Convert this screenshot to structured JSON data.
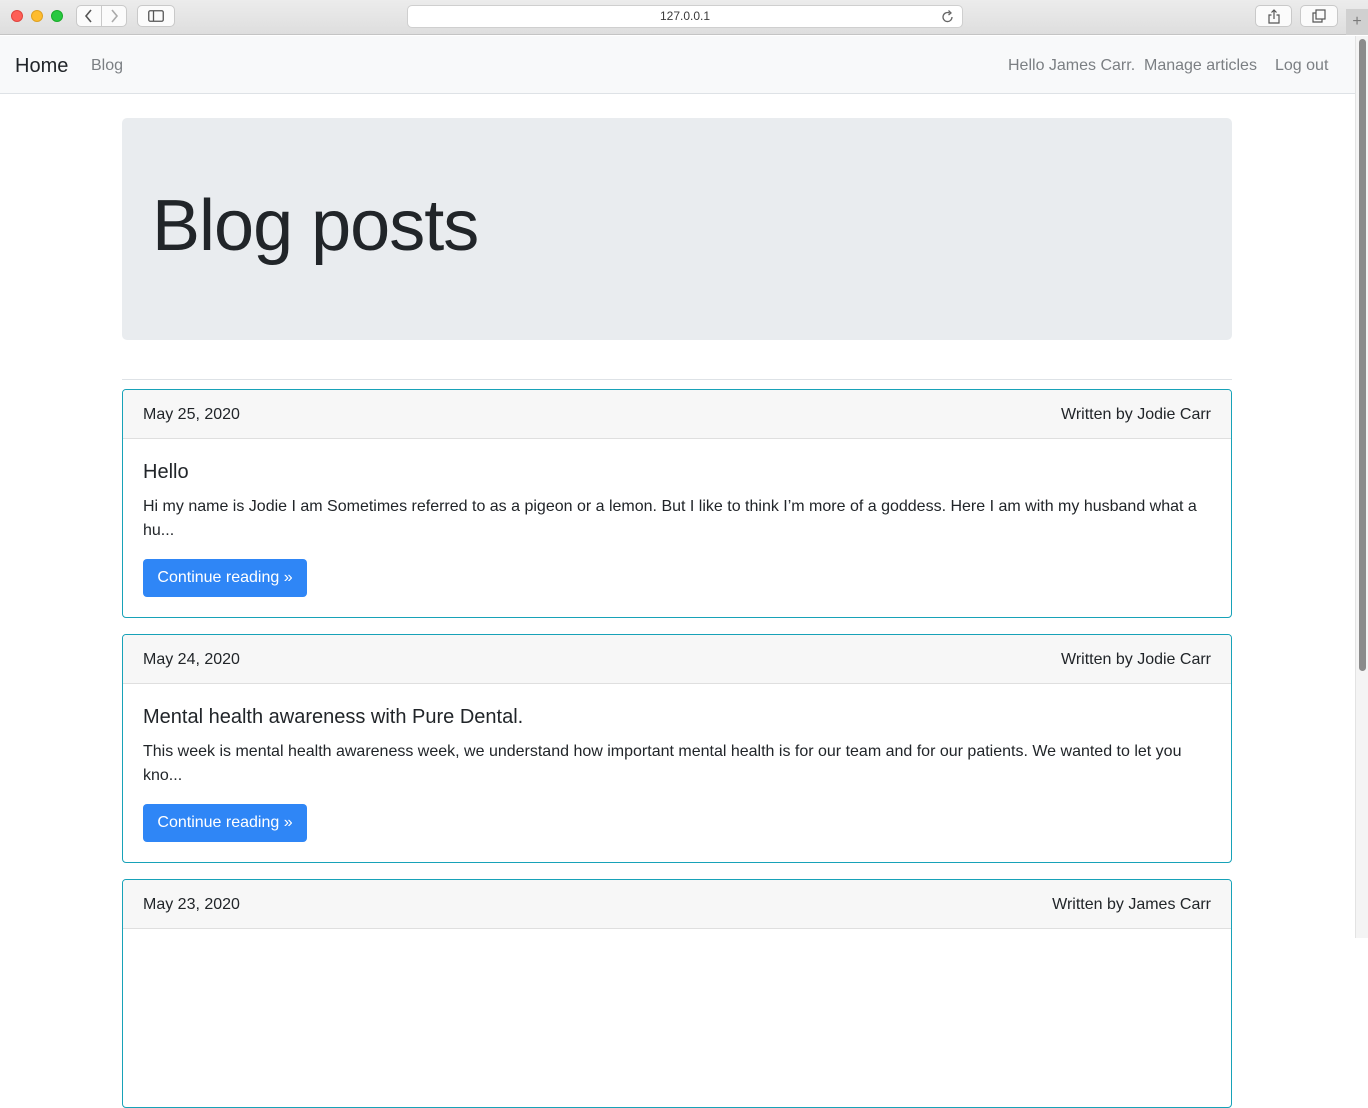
{
  "browser": {
    "url": "127.0.0.1",
    "icons": [
      "back-icon",
      "forward-icon",
      "sidebar-icon",
      "reload-icon",
      "share-icon",
      "tabs-icon",
      "new-tab-icon"
    ]
  },
  "navbar": {
    "brand": "Home",
    "blog": "Blog",
    "greeting": "Hello James Carr.",
    "manage": "Manage articles",
    "logout": "Log out"
  },
  "jumbotron": {
    "title": "Blog posts"
  },
  "posts": [
    {
      "date": "May 25, 2020",
      "author": "Written by Jodie Carr",
      "title": "Hello",
      "excerpt": "Hi my name is Jodie I am Sometimes referred to as a pigeon or a lemon. But I like to think I’m more of a goddess. Here I am with my husband what a hu...",
      "button": "Continue reading »"
    },
    {
      "date": "May 24, 2020",
      "author": "Written by Jodie Carr",
      "title": "Mental health awareness with Pure Dental.",
      "excerpt": "This week is mental health awareness week, we understand how important mental health is for our team and for our patients. We wanted to let you kno...",
      "button": "Continue reading »"
    },
    {
      "date": "May 23, 2020",
      "author": "Written by James Carr",
      "title": "",
      "excerpt": "",
      "button": ""
    }
  ],
  "colors": {
    "accent": "#2f86f6",
    "card_border": "#17a2b8",
    "jumbotron_bg": "#e9ecef",
    "navbar_bg": "#f8f9fa"
  }
}
